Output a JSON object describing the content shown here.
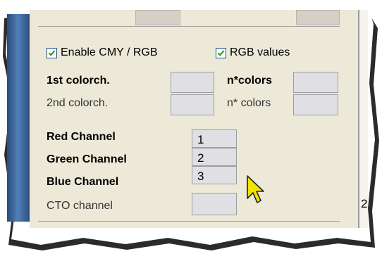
{
  "checkboxes": {
    "cmy_rgb": {
      "label": "Enable CMY / RGB",
      "checked": true
    },
    "rgb_values": {
      "label": "RGB values",
      "checked": true
    }
  },
  "color_fields": {
    "first": "1st colorch.",
    "second": "2nd colorch.",
    "ncolors_bold": "n*colors",
    "ncolors": "n* colors"
  },
  "channels": [
    {
      "label": "Red Channel",
      "value": "1"
    },
    {
      "label": "Green Channel",
      "value": "2"
    },
    {
      "label": "Blue Channel",
      "value": "3"
    },
    {
      "label": "CTO channel",
      "value": ""
    }
  ],
  "right_fragment": "2",
  "colors": {
    "check_accent": "#2f9a2f",
    "cursor": "#f2e400"
  }
}
